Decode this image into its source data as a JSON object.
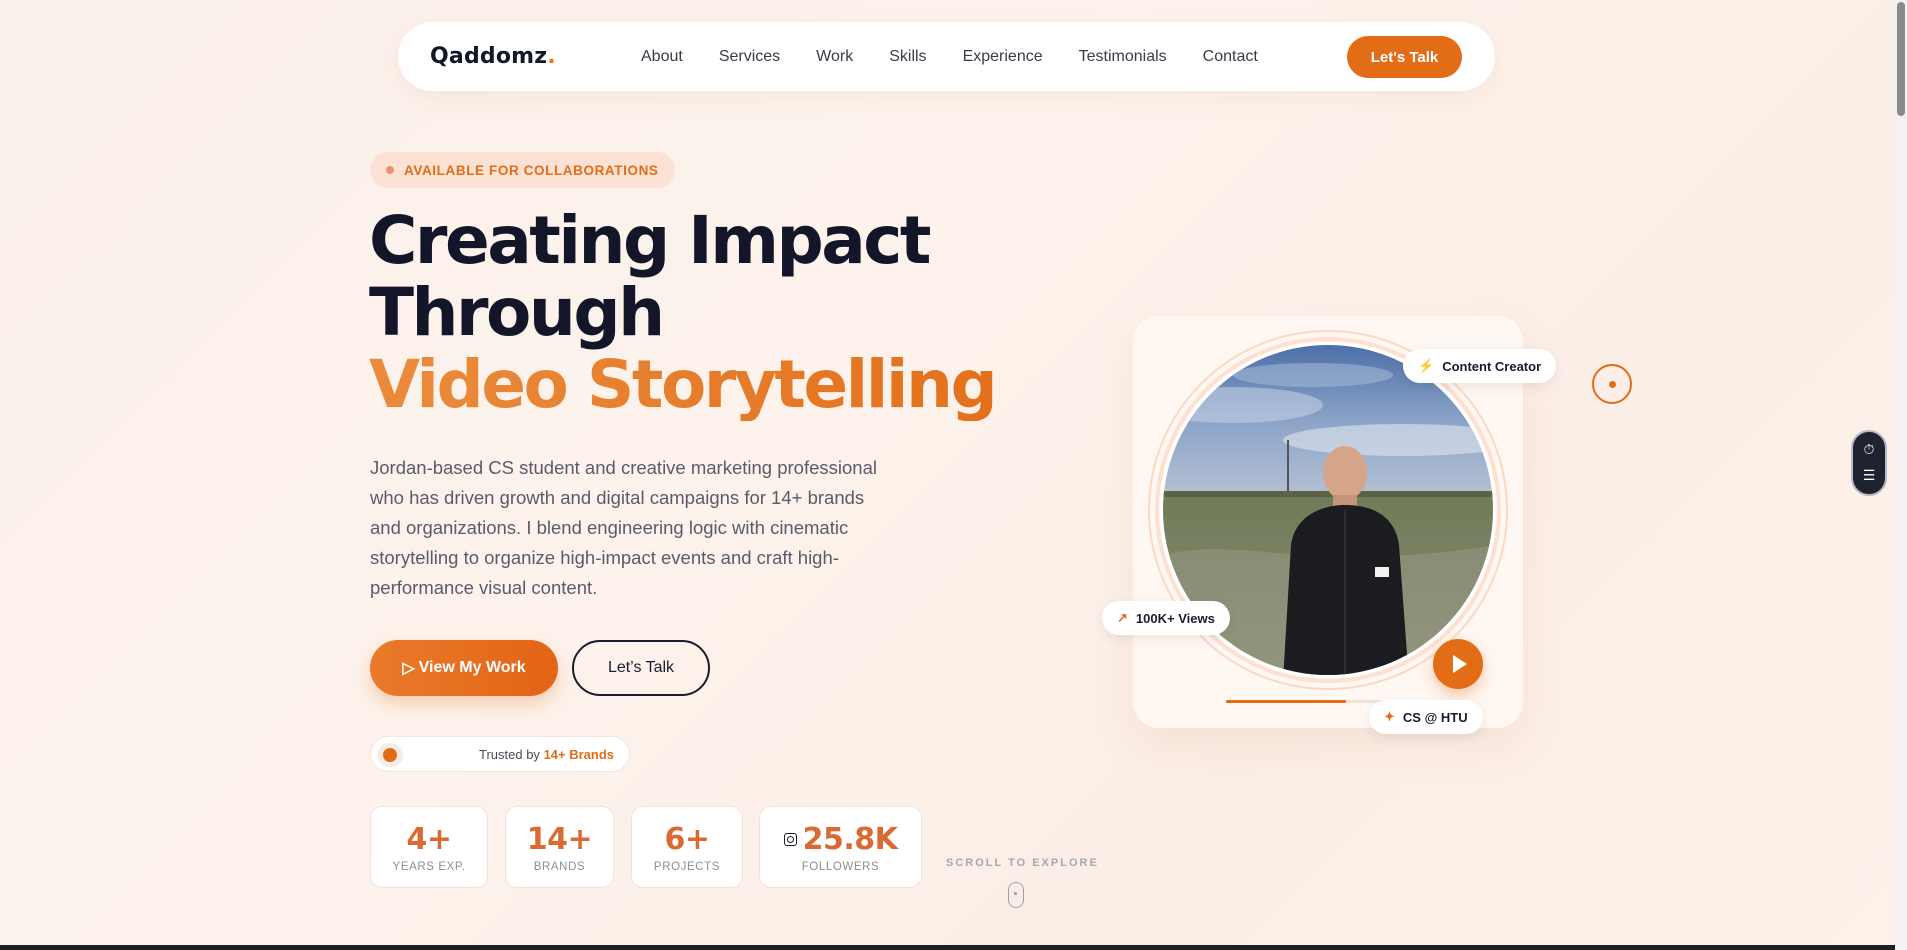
{
  "nav": {
    "logo": "Qaddomz",
    "logo_dot": ".",
    "links": [
      "About",
      "Services",
      "Work",
      "Skills",
      "Experience",
      "Testimonials",
      "Contact"
    ],
    "cta": "Let's Talk"
  },
  "hero": {
    "badge": "AVAILABLE FOR COLLABORATIONS",
    "headline_line1": "Creating Impact",
    "headline_line2": "Through",
    "headline_line3": "Video Storytelling",
    "lead": "Jordan-based CS student and creative marketing professional who has driven growth and digital campaigns for 14+ brands and organizations. I blend engineering logic with cinematic storytelling to organize high-impact events and craft high-performance visual content.",
    "primary_btn": "View My Work",
    "primary_btn_icon": "▷",
    "secondary_btn": "Let’s Talk",
    "trusted_prefix": "Trusted by",
    "trusted_value": "14+ Brands"
  },
  "stats": [
    {
      "value": "4+",
      "label": "YEARS EXP."
    },
    {
      "value": "14+",
      "label": "BRANDS"
    },
    {
      "value": "6+",
      "label": "PROJECTS"
    },
    {
      "value": "25.8K",
      "label": "FOLLOWERS",
      "icon": "instagram-icon"
    }
  ],
  "scroll_hint": "SCROLL TO EXPLORE",
  "media": {
    "pill_top": "Content Creator",
    "pill_left": "100K+ Views",
    "pill_bottom": "CS @ HTU",
    "progress_percent": 60
  },
  "colors": {
    "accent": "#e36c17",
    "accent_light": "#ea8c3c",
    "ink": "#131528",
    "background": "#fbf0e9"
  }
}
